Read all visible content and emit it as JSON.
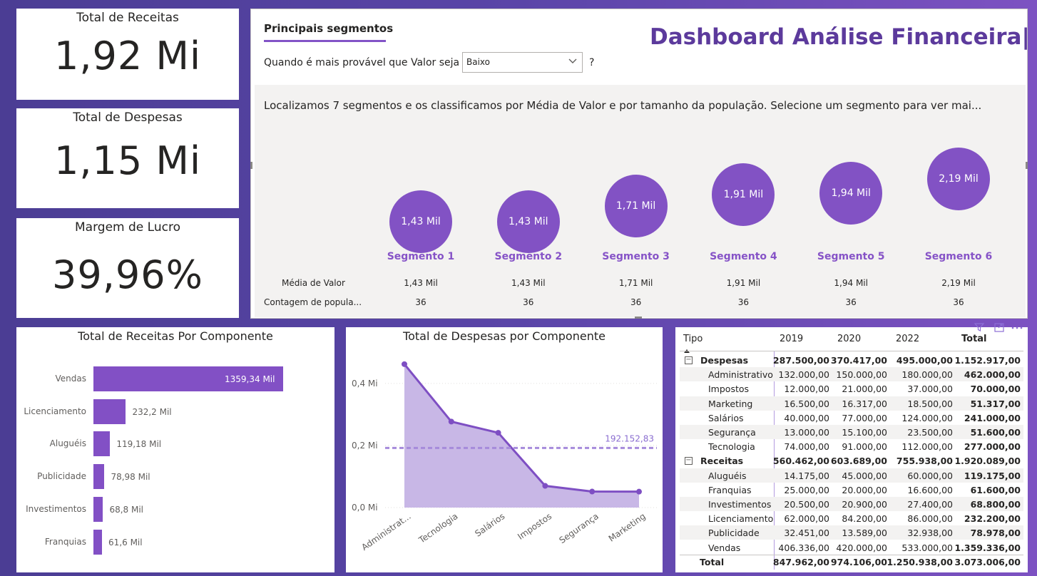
{
  "kpis": [
    {
      "title": "Total de Receitas",
      "value": "1,92 Mi"
    },
    {
      "title": "Total de Despesas",
      "value": "1,15 Mi"
    },
    {
      "title": "Margem de Lucro",
      "value": "39,96%"
    }
  ],
  "dashboard_title": "Dashboard Análise Financeira|",
  "segments": {
    "heading": "Principais segmentos",
    "question": "Quando é mais provável que Valor seja",
    "selected": "Baixo",
    "question_mark": "?",
    "description": "Localizamos 7 segmentos e os classificamos por Média de Valor e por tamanho da população. Selecione um segmento para ver mai...",
    "row_labels": [
      "Média de Valor",
      "Contagem de popula..."
    ],
    "items": [
      {
        "name": "Segmento 1",
        "bubble": "1,43 Mil",
        "media": "1,43 Mil",
        "contagem": "36",
        "value": 1430
      },
      {
        "name": "Segmento 2",
        "bubble": "1,43 Mil",
        "media": "1,43 Mil",
        "contagem": "36",
        "value": 1430
      },
      {
        "name": "Segmento 3",
        "bubble": "1,71 Mil",
        "media": "1,71 Mil",
        "contagem": "36",
        "value": 1710
      },
      {
        "name": "Segmento 4",
        "bubble": "1,91 Mil",
        "media": "1,91 Mil",
        "contagem": "36",
        "value": 1910
      },
      {
        "name": "Segmento 5",
        "bubble": "1,94 Mil",
        "media": "1,94 Mil",
        "contagem": "36",
        "value": 1940
      },
      {
        "name": "Segmento 6",
        "bubble": "2,19 Mil",
        "media": "2,19 Mil",
        "contagem": "36",
        "value": 2190
      }
    ]
  },
  "receitas_chart": {
    "title": "Total de Receitas Por Componente",
    "chart_data": {
      "type": "bar",
      "categories": [
        "Vendas",
        "Licenciamento",
        "Aluguéis",
        "Publicidade",
        "Investimentos",
        "Franquias"
      ],
      "values": [
        1359.34,
        232.2,
        119.18,
        78.98,
        68.8,
        61.6
      ],
      "labels": [
        "1359,34 Mil",
        "232,2 Mil",
        "119,18 Mil",
        "78,98 Mil",
        "68,8 Mil",
        "61,6 Mil"
      ],
      "orientation": "horizontal"
    }
  },
  "despesas_chart": {
    "title": "Total de Despesas por Componente",
    "chart_data": {
      "type": "area",
      "categories": [
        "Administrat...",
        "Tecnologia",
        "Salários",
        "Impostos",
        "Segurança",
        "Marketing"
      ],
      "values": [
        462000,
        277000,
        241000,
        70000,
        51600,
        51317
      ],
      "y_ticks": [
        "0,0 Mi",
        "0,2 Mi",
        "0,4 Mi"
      ],
      "y_tick_values": [
        0,
        200000,
        400000
      ],
      "ylim": [
        0,
        480000
      ],
      "average_line": {
        "value": 192152.83,
        "label": "192.152,83"
      }
    }
  },
  "matrix": {
    "headers": [
      "Tipo",
      "2019",
      "2020",
      "2022",
      "Total"
    ],
    "rows": [
      {
        "label": "Despesas",
        "level": 0,
        "toggle": "−",
        "cells": [
          "287.500,00",
          "370.417,00",
          "495.000,00",
          "1.152.917,00"
        ]
      },
      {
        "label": "Administrativo",
        "level": 1,
        "cells": [
          "132.000,00",
          "150.000,00",
          "180.000,00",
          "462.000,00"
        ]
      },
      {
        "label": "Impostos",
        "level": 1,
        "cells": [
          "12.000,00",
          "21.000,00",
          "37.000,00",
          "70.000,00"
        ]
      },
      {
        "label": "Marketing",
        "level": 1,
        "cells": [
          "16.500,00",
          "16.317,00",
          "18.500,00",
          "51.317,00"
        ]
      },
      {
        "label": "Salários",
        "level": 1,
        "cells": [
          "40.000,00",
          "77.000,00",
          "124.000,00",
          "241.000,00"
        ]
      },
      {
        "label": "Segurança",
        "level": 1,
        "cells": [
          "13.000,00",
          "15.100,00",
          "23.500,00",
          "51.600,00"
        ]
      },
      {
        "label": "Tecnologia",
        "level": 1,
        "cells": [
          "74.000,00",
          "91.000,00",
          "112.000,00",
          "277.000,00"
        ]
      },
      {
        "label": "Receitas",
        "level": 0,
        "toggle": "−",
        "cells": [
          "560.462,00",
          "603.689,00",
          "755.938,00",
          "1.920.089,00"
        ]
      },
      {
        "label": "Aluguéis",
        "level": 1,
        "cells": [
          "14.175,00",
          "45.000,00",
          "60.000,00",
          "119.175,00"
        ]
      },
      {
        "label": "Franquias",
        "level": 1,
        "cells": [
          "25.000,00",
          "20.000,00",
          "16.600,00",
          "61.600,00"
        ]
      },
      {
        "label": "Investimentos",
        "level": 1,
        "cells": [
          "20.500,00",
          "20.900,00",
          "27.400,00",
          "68.800,00"
        ]
      },
      {
        "label": "Licenciamento",
        "level": 1,
        "cells": [
          "62.000,00",
          "84.200,00",
          "86.000,00",
          "232.200,00"
        ]
      },
      {
        "label": "Publicidade",
        "level": 1,
        "cells": [
          "32.451,00",
          "13.589,00",
          "32.938,00",
          "78.978,00"
        ]
      },
      {
        "label": "Vendas",
        "level": 1,
        "cells": [
          "406.336,00",
          "420.000,00",
          "533.000,00",
          "1.359.336,00"
        ]
      },
      {
        "label": "Total",
        "level": 0,
        "cells": [
          "847.962,00",
          "974.106,00",
          "1.250.938,00",
          "3.073.006,00"
        ]
      }
    ]
  },
  "colors": {
    "accent": "#8250c5",
    "title": "#5c3a9c",
    "background": "#5a45a8"
  },
  "icons": [
    "filter-icon",
    "focus-mode-icon",
    "more-options-icon",
    "chevron-down-icon",
    "sort-up-icon"
  ]
}
